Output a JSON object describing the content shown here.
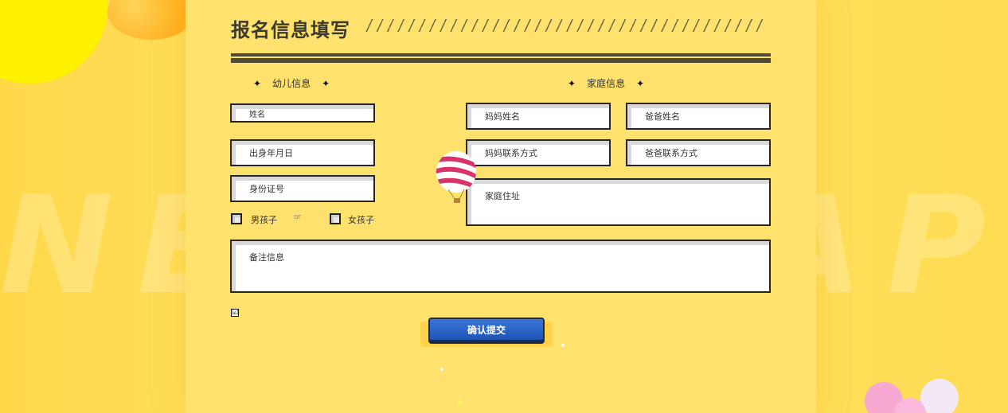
{
  "page": {
    "title": "报名信息填写",
    "watermark": "NEW CHAPTER"
  },
  "child_section": {
    "heading": "幼儿信息",
    "name_placeholder": "姓名",
    "birth_placeholder": "出身年月日",
    "id_placeholder": "身份证号",
    "boy_label": "男孩子",
    "or_label": "or",
    "girl_label": "女孩子"
  },
  "family_section": {
    "heading": "家庭信息",
    "mother_name_placeholder": "妈妈姓名",
    "father_name_placeholder": "爸爸姓名",
    "mother_contact_placeholder": "妈妈联系方式",
    "father_contact_placeholder": "爸爸联系方式",
    "address_placeholder": "家庭住址"
  },
  "notes_placeholder": "备注信息",
  "agree_checked_mark": "☑",
  "submit_label": "确认提交",
  "colors": {
    "background": "#ffdc52",
    "panel": "#ffe26e",
    "accent_blue": "#2a62c4",
    "dark_line": "#4e4a33"
  },
  "icons": {
    "star": "four-point-star",
    "balloon": "striped-hot-air-balloon"
  }
}
